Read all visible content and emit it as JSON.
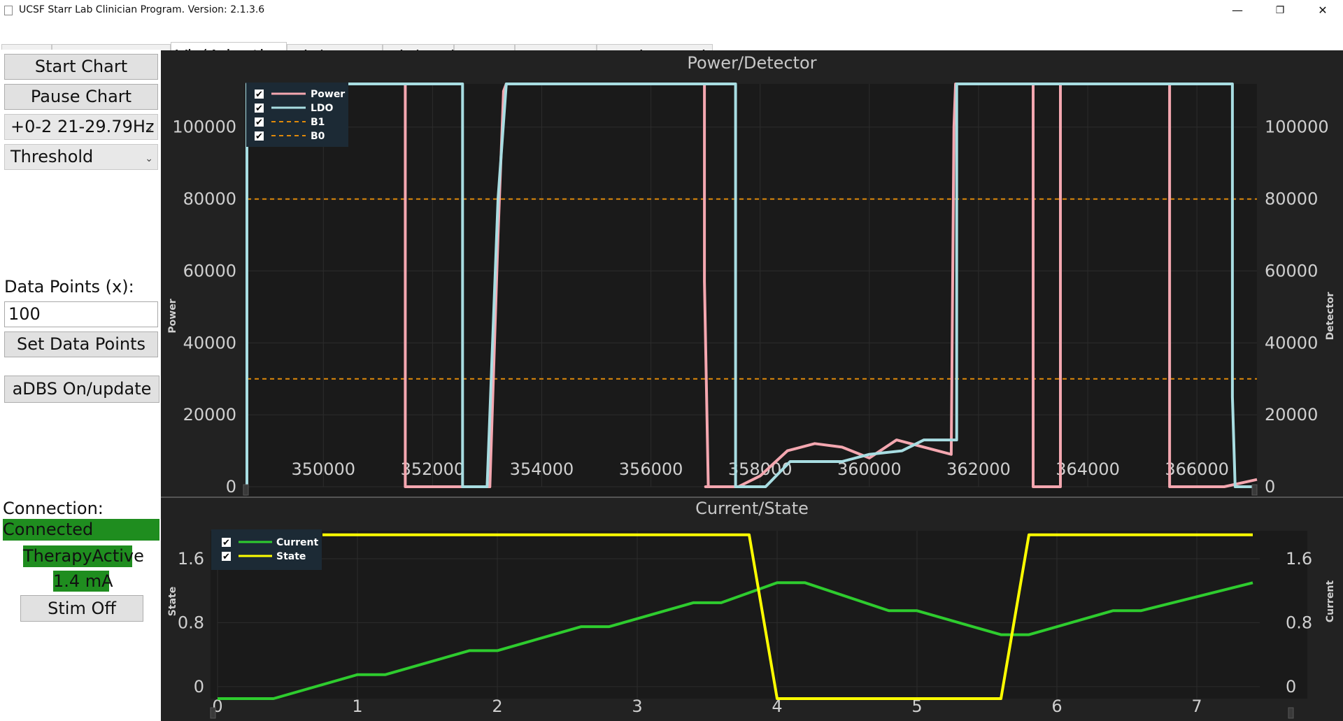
{
  "window": {
    "title": "UCSF Starr Lab Clinician Program. Version: 2.1.3.6",
    "minimize": "—",
    "maximize": "❐",
    "close": "✕"
  },
  "tabs": [
    "Main",
    "Sense Settings",
    "Vis(Adaptive)",
    "Vis(TD/Acc)",
    "Vis(FFT)",
    "Report",
    "Montage",
    "Lead Integrity"
  ],
  "active_tab": "Vis(Adaptive)",
  "left_panel": {
    "start_chart": "Start Chart",
    "pause_chart": "Pause Chart",
    "band_select": "+0-2 21-29.79Hz",
    "mode_select": "Threshold",
    "data_points_label": "Data Points (x):",
    "data_points_value": "100",
    "set_data_points": "Set Data Points",
    "adbs_button": "aDBS On/update",
    "connection_label": "Connection:",
    "connection_status": "Connected",
    "therapy_status": "TherapyActive",
    "current_amp": "1.4  mA",
    "stim_off": "Stim Off"
  },
  "colors": {
    "power": "#f4a7b0",
    "ldo": "#a8dde2",
    "threshold": "#e08a0a",
    "current": "#2ecc2e",
    "state": "#ffff00",
    "status_green": "#1f8d1f"
  },
  "chart_data": [
    {
      "type": "line",
      "title": "Power/Detector",
      "ylabel": "Power",
      "y2label": "Detector",
      "xlim": [
        348600,
        367100
      ],
      "ylim": [
        0,
        112000
      ],
      "x_ticks": [
        "350000",
        "352000",
        "354000",
        "356000",
        "358000",
        "360000",
        "362000",
        "364000",
        "366000"
      ],
      "x_tick_values": [
        350000,
        352000,
        354000,
        356000,
        358000,
        360000,
        362000,
        364000,
        366000
      ],
      "y_ticks": [
        "0",
        "20000",
        "40000",
        "60000",
        "80000",
        "100000"
      ],
      "y_tick_values": [
        0,
        20000,
        40000,
        60000,
        80000,
        100000
      ],
      "legend": [
        {
          "name": "Power",
          "style": "solid"
        },
        {
          "name": "LDO",
          "style": "solid"
        },
        {
          "name": "B1",
          "style": "dashed"
        },
        {
          "name": "B0",
          "style": "dashed"
        }
      ],
      "thresholds": [
        {
          "name": "B1",
          "value": 80000
        },
        {
          "name": "B0",
          "value": 30000
        }
      ],
      "series": [
        {
          "name": "Power",
          "x": [
            351500,
            351500,
            352550,
            353050,
            353200,
            353300,
            353350,
            356980,
            356980,
            357050,
            357000,
            357600,
            358000,
            358500,
            359000,
            359500,
            360000,
            360500,
            361000,
            361500,
            361550,
            361580,
            363000,
            363000,
            363500,
            363500,
            365500,
            365500,
            366500,
            367100
          ],
          "y": [
            115000,
            0,
            0,
            0,
            70000,
            110000,
            115000,
            115000,
            57000,
            0,
            0,
            0,
            3000,
            10000,
            12000,
            11000,
            8000,
            13000,
            11000,
            9000,
            100000,
            115000,
            115000,
            0,
            0,
            115000,
            115000,
            0,
            0,
            2000
          ]
        },
        {
          "name": "LDO",
          "x": [
            348600,
            348600,
            352550,
            352550,
            353000,
            353200,
            353350,
            357550,
            357550,
            358100,
            358550,
            359500,
            360000,
            360600,
            361000,
            361600,
            361600,
            366650,
            366650,
            366700,
            367100
          ],
          "y": [
            0,
            115000,
            115000,
            0,
            0,
            80000,
            115000,
            115000,
            0,
            0,
            7000,
            7000,
            9000,
            10000,
            13000,
            13000,
            115000,
            115000,
            25000,
            0,
            0
          ]
        }
      ]
    },
    {
      "type": "line",
      "title": "Current/State",
      "ylabel": "State",
      "y2label": "Current",
      "xlim": [
        0,
        7.45
      ],
      "ylim": [
        -0.15,
        1.95
      ],
      "x_ticks": [
        "0",
        "1",
        "2",
        "3",
        "4",
        "5",
        "6",
        "7"
      ],
      "x_tick_values": [
        0,
        1,
        2,
        3,
        4,
        5,
        6,
        7
      ],
      "y_ticks": [
        "0",
        "0.8",
        "1.6"
      ],
      "y_tick_values": [
        0,
        0.8,
        1.6
      ],
      "legend": [
        {
          "name": "Current",
          "style": "solid"
        },
        {
          "name": "State",
          "style": "solid"
        }
      ],
      "series": [
        {
          "name": "Current",
          "x": [
            0,
            0.4,
            1.0,
            1.2,
            1.8,
            2.0,
            2.6,
            2.8,
            3.4,
            3.6,
            4.0,
            4.2,
            4.8,
            5.0,
            5.6,
            5.8,
            6.4,
            6.6,
            7.4
          ],
          "y": [
            -0.15,
            -0.15,
            0.15,
            0.15,
            0.45,
            0.45,
            0.75,
            0.75,
            1.05,
            1.05,
            1.3,
            1.3,
            0.95,
            0.95,
            0.65,
            0.65,
            0.95,
            0.95,
            1.3
          ]
        },
        {
          "name": "State",
          "x": [
            0.75,
            3.8,
            4.0,
            5.6,
            5.8,
            7.4
          ],
          "y": [
            1.9,
            1.9,
            -0.15,
            -0.15,
            1.9,
            1.9
          ]
        }
      ]
    }
  ]
}
